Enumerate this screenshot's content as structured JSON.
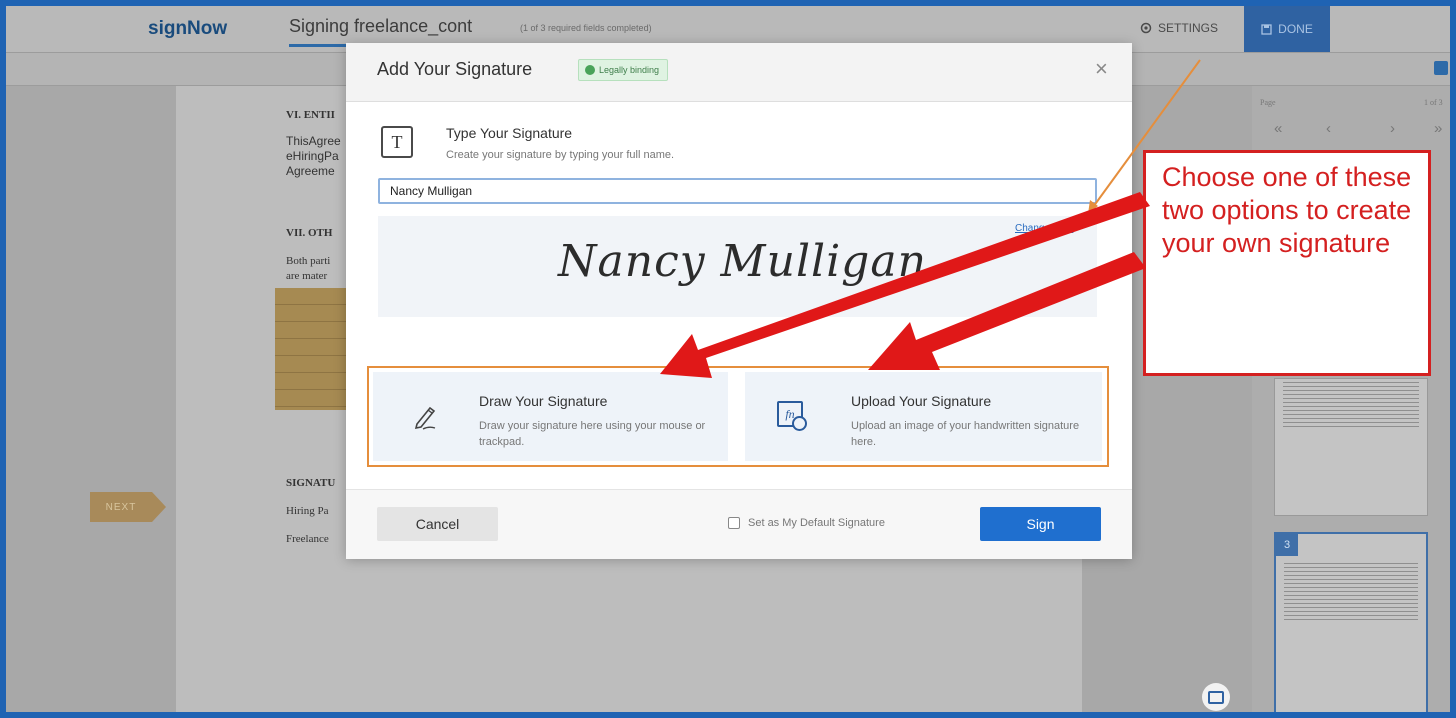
{
  "app": {
    "logo": "signNow",
    "document_title": "Signing freelance_cont",
    "document_status": "(1 of 3 required fields completed)",
    "settings_label": "SETTINGS",
    "done_label": "DONE"
  },
  "document": {
    "section6_heading": "VI. ENTII",
    "section6_lines": [
      "ThisAgree",
      "eHiringPa",
      "Agreeme"
    ],
    "section7_heading": "VII. OTH",
    "section7_lines": [
      "Both parti",
      "are mater"
    ],
    "signature_heading": "SIGNATU",
    "signature_lines": [
      "Hiring Pa",
      "Freelance"
    ],
    "next_label": "NEXT"
  },
  "side_panel": {
    "page_label": "Page",
    "page_of": "1 of 3",
    "nav": [
      "«",
      "‹",
      "›",
      "»"
    ],
    "current_page_number": "3"
  },
  "modal": {
    "title": "Add Your Signature",
    "badge": "Legally binding",
    "close_label": "×",
    "type_icon_label": "T",
    "type_title": "Type Your Signature",
    "type_description": "Create your signature by typing your full name.",
    "name_value": "Nancy Mulligan",
    "change_style": "Change style",
    "preview_signature": "Nancy Mulligan",
    "draw_title": "Draw Your Signature",
    "draw_description": "Draw your signature here using your mouse or trackpad.",
    "upload_icon_label": "fn",
    "upload_title": "Upload Your Signature",
    "upload_description": "Upload an image of your handwritten signature here.",
    "cancel_label": "Cancel",
    "default_checkbox_label": "Set as My Default Signature",
    "sign_label": "Sign"
  },
  "annotation": {
    "callout_text": "Choose one of these two options to create your own signature",
    "arrow_color": "#e01818",
    "highlight_color": "#e58e3c"
  },
  "icons": {
    "settings": "gear-icon",
    "done": "save-icon",
    "badge": "shield-check-icon",
    "type": "text-t-icon",
    "draw": "pen-icon",
    "upload": "upload-image-icon",
    "chat": "chat-icon"
  }
}
